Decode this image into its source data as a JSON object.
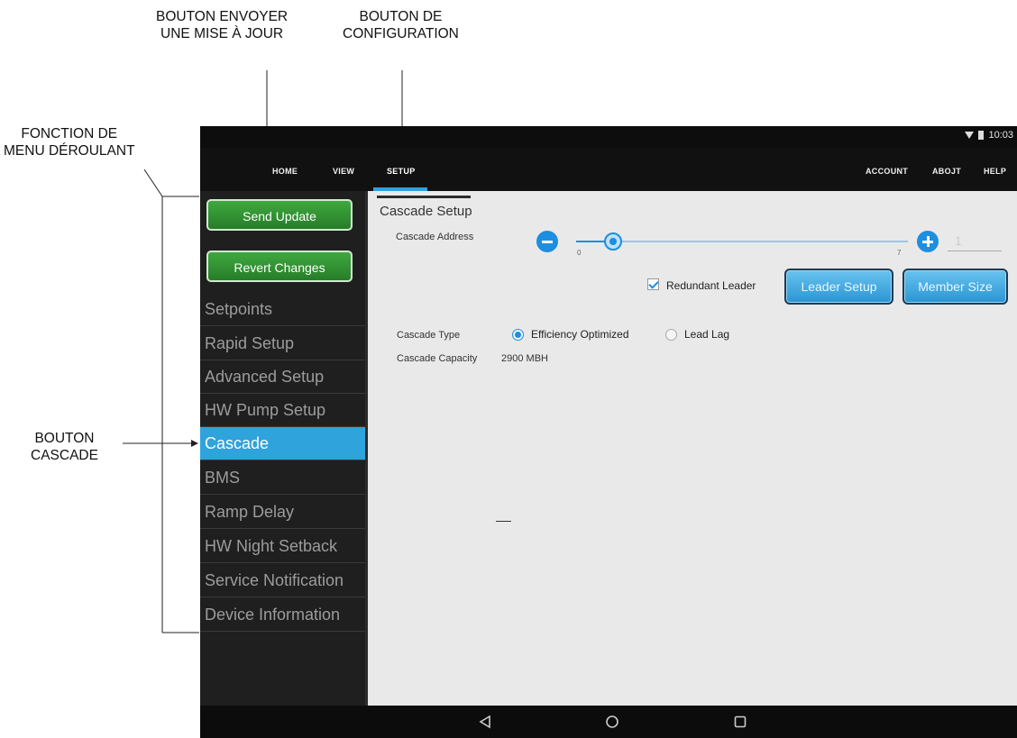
{
  "callouts": {
    "send_update_line1": "BOUTON ENVOYER",
    "send_update_line2": "UNE MISE À JOUR",
    "config_line1": "BOUTON DE",
    "config_line2": "CONFIGURATION",
    "dropdown_line1": "FONCTION DE",
    "dropdown_line2": "MENU DÉROULANT",
    "cascade_line1": "BOUTON",
    "cascade_line2": "CASCADE"
  },
  "status": {
    "time": "10:03"
  },
  "appbar": {
    "home": "HOME",
    "view": "VIEW",
    "setup": "SETUP",
    "account": "ACCOUNT",
    "about": "ABOJT",
    "help": "HELP"
  },
  "sidebar": {
    "send_update": "Send Update",
    "revert_changes": "Revert Changes",
    "items": [
      "Setpoints",
      "Rapid Setup",
      "Advanced Setup",
      "HW Pump Setup",
      "Cascade",
      "BMS",
      "Ramp Delay",
      "HW Night Setback",
      "Service Notification",
      "Device Information"
    ],
    "active_index": 4
  },
  "cascade": {
    "title": "Cascade Setup",
    "address_label": "Cascade Address",
    "slider": {
      "min_label": "0",
      "max_label": "7",
      "value": 1
    },
    "address_value": "1",
    "redundant_leader": "Redundant Leader",
    "redundant_leader_checked": true,
    "leader_setup": "Leader Setup",
    "member_size": "Member Size",
    "type_label": "Cascade Type",
    "type_options": [
      "Efficiency Optimized",
      "Lead Lag"
    ],
    "type_selected": "Efficiency Optimized",
    "capacity_label": "Cascade Capacity",
    "capacity_value": "2900 MBH"
  },
  "colors": {
    "accent": "#2ea3dc",
    "green_button": "#3fa83f",
    "sidebar_bg": "#1f1f1f",
    "content_bg": "#e9e9e9"
  },
  "icons": [
    "wifi-icon",
    "battery-icon",
    "back-icon",
    "home-circle-icon",
    "recents-square-icon",
    "minus-icon",
    "plus-icon",
    "checkbox-icon"
  ]
}
